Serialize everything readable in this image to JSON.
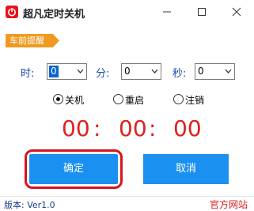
{
  "window": {
    "title": "超凡定时关机",
    "min_icon": "minimize-icon",
    "max_icon": "maximize-icon",
    "close_icon": "close-icon",
    "app_icon": "power-icon"
  },
  "hint": {
    "label": "车前提醒"
  },
  "time": {
    "hour_label": "时:",
    "hour_value": "0",
    "minute_label": "分:",
    "minute_value": "0",
    "second_label": "秒:",
    "second_value": "0"
  },
  "mode": {
    "shutdown": "关机",
    "restart": "重启",
    "logout": "注销",
    "selected": "shutdown"
  },
  "countdown": {
    "hours": "00",
    "minutes": "00",
    "seconds": "00",
    "separator": ":"
  },
  "buttons": {
    "ok": "确定",
    "cancel": "取消"
  },
  "status": {
    "version": "版本: Ver1.0",
    "site": "官方网站"
  },
  "colors": {
    "accent": "#1a90f0",
    "countdown": "#e0201f",
    "hint": "#f09a20"
  }
}
